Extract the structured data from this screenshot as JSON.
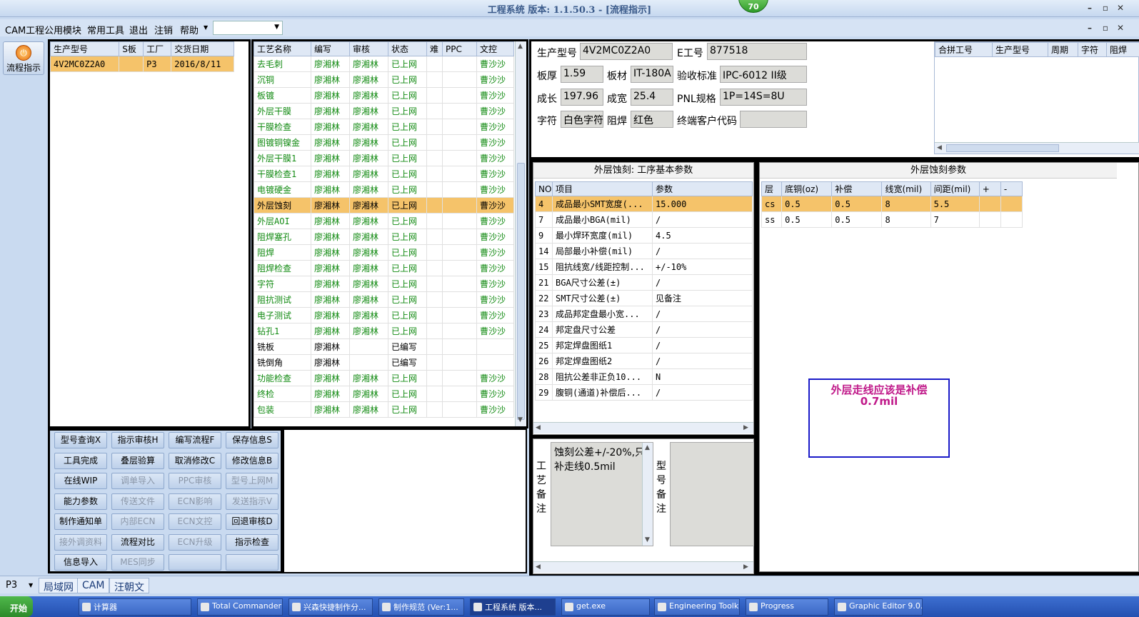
{
  "window": {
    "title": "工程系统  版本: 1.1.50.3 - [流程指示]",
    "badge": "70"
  },
  "menu": {
    "items": [
      "CAM工程",
      "公用模块",
      "常用工具",
      "退出",
      "注销",
      "帮助"
    ],
    "combo_value": ""
  },
  "sidebar": {
    "flow_button": "流程指示"
  },
  "order_table": {
    "headers": [
      "生产型号",
      "S板",
      "工厂",
      "交货日期"
    ],
    "rows": [
      [
        "4V2MC0Z2A0",
        "",
        "P3",
        "2016/8/11"
      ]
    ]
  },
  "process_table": {
    "headers": [
      "工艺名称",
      "编写",
      "审核",
      "状态",
      "难",
      "PPC",
      "文控"
    ],
    "selected_index": 9,
    "rows": [
      [
        "去毛刺",
        "廖湘林",
        "廖湘林",
        "已上网",
        "",
        "",
        "曹沙沙"
      ],
      [
        "沉铜",
        "廖湘林",
        "廖湘林",
        "已上网",
        "",
        "",
        "曹沙沙"
      ],
      [
        "板镀",
        "廖湘林",
        "廖湘林",
        "已上网",
        "",
        "",
        "曹沙沙"
      ],
      [
        "外层干膜",
        "廖湘林",
        "廖湘林",
        "已上网",
        "",
        "",
        "曹沙沙"
      ],
      [
        "干膜检查",
        "廖湘林",
        "廖湘林",
        "已上网",
        "",
        "",
        "曹沙沙"
      ],
      [
        "图镀铜镍金",
        "廖湘林",
        "廖湘林",
        "已上网",
        "",
        "",
        "曹沙沙"
      ],
      [
        "外层干膜1",
        "廖湘林",
        "廖湘林",
        "已上网",
        "",
        "",
        "曹沙沙"
      ],
      [
        "干膜检查1",
        "廖湘林",
        "廖湘林",
        "已上网",
        "",
        "",
        "曹沙沙"
      ],
      [
        "电镀硬金",
        "廖湘林",
        "廖湘林",
        "已上网",
        "",
        "",
        "曹沙沙"
      ],
      [
        "外层蚀刻",
        "廖湘林",
        "廖湘林",
        "已上网",
        "",
        "",
        "曹沙沙"
      ],
      [
        "外层AOI",
        "廖湘林",
        "廖湘林",
        "已上网",
        "",
        "",
        "曹沙沙"
      ],
      [
        "阻焊塞孔",
        "廖湘林",
        "廖湘林",
        "已上网",
        "",
        "",
        "曹沙沙"
      ],
      [
        "阻焊",
        "廖湘林",
        "廖湘林",
        "已上网",
        "",
        "",
        "曹沙沙"
      ],
      [
        "阻焊检查",
        "廖湘林",
        "廖湘林",
        "已上网",
        "",
        "",
        "曹沙沙"
      ],
      [
        "字符",
        "廖湘林",
        "廖湘林",
        "已上网",
        "",
        "",
        "曹沙沙"
      ],
      [
        "阻抗测试",
        "廖湘林",
        "廖湘林",
        "已上网",
        "",
        "",
        "曹沙沙"
      ],
      [
        "电子测试",
        "廖湘林",
        "廖湘林",
        "已上网",
        "",
        "",
        "曹沙沙"
      ],
      [
        "钻孔1",
        "廖湘林",
        "廖湘林",
        "已上网",
        "",
        "",
        "曹沙沙"
      ],
      [
        "铣板",
        "廖湘林",
        "",
        "已编写",
        "",
        "",
        ""
      ],
      [
        "铣倒角",
        "廖湘林",
        "",
        "已编写",
        "",
        "",
        ""
      ],
      [
        "功能检查",
        "廖湘林",
        "廖湘林",
        "已上网",
        "",
        "",
        "曹沙沙"
      ],
      [
        "终检",
        "廖湘林",
        "廖湘林",
        "已上网",
        "",
        "",
        "曹沙沙"
      ],
      [
        "包装",
        "廖湘林",
        "廖湘林",
        "已上网",
        "",
        "",
        "曹沙沙"
      ]
    ]
  },
  "buttons": [
    [
      "型号查询X",
      "指示审核H",
      "编写流程F",
      "保存信息S"
    ],
    [
      "工具完成",
      "叠层验算",
      "取消修改C",
      "修改信息B"
    ],
    [
      "在线WIP",
      "调单导入",
      "PPC审核",
      "型号上网M"
    ],
    [
      "能力参数",
      "传送文件",
      "ECN影响",
      "发送指示V"
    ],
    [
      "制作通知单",
      "内部ECN",
      "ECN文控",
      "回退审核D"
    ],
    [
      "接外调资料",
      "流程对比",
      "ECN升级",
      "指示检查"
    ],
    [
      "信息导入",
      "MES同步",
      "",
      ""
    ]
  ],
  "button_disabled": [
    [
      false,
      false,
      false,
      false
    ],
    [
      false,
      false,
      false,
      false
    ],
    [
      false,
      true,
      true,
      true
    ],
    [
      false,
      true,
      true,
      true
    ],
    [
      false,
      true,
      true,
      false
    ],
    [
      true,
      false,
      true,
      false
    ],
    [
      false,
      true,
      false,
      false
    ]
  ],
  "info": {
    "model_label": "生产型号",
    "model": "4V2MC0Z2A0",
    "e_label": "E工号",
    "e_no": "877518",
    "thick_label": "板厚",
    "thick": "1.59",
    "material_label": "板材",
    "material": "IT-180A",
    "std_label": "验收标准",
    "std": "IPC-6012 II级",
    "len_label": "成长",
    "len": "197.96",
    "wid_label": "成宽",
    "wid": "25.4",
    "pnl_label": "PNL规格",
    "pnl": "1P=14S=8U",
    "char_label": "字符",
    "char": "白色字符",
    "mask_label": "阻焊",
    "mask": "红色",
    "cust_label": "终端客户代码",
    "cust": ""
  },
  "merge_table": {
    "headers": [
      "合拼工号",
      "生产型号",
      "周期",
      "字符",
      "阻焊"
    ]
  },
  "params": {
    "title": "外层蚀刻: 工序基本参数",
    "headers": [
      "NO",
      "项目",
      "参数"
    ],
    "rows": [
      [
        "4",
        "成品最小SMT宽度(...",
        "15.000"
      ],
      [
        "7",
        "成品最小BGA(mil)",
        "/"
      ],
      [
        "9",
        "最小焊环宽度(mil)",
        "4.5"
      ],
      [
        "14",
        "局部最小补偿(mil)",
        "/"
      ],
      [
        "15",
        "阻抗线宽/线距控制...",
        "+/-10%"
      ],
      [
        "21",
        "BGA尺寸公差(±)",
        "/"
      ],
      [
        "22",
        "SMT尺寸公差(±)",
        "见备注"
      ],
      [
        "23",
        "成品邦定盘最小宽...",
        "/"
      ],
      [
        "24",
        "邦定盘尺寸公差",
        "/"
      ],
      [
        "25",
        "邦定焊盘图纸1",
        "/"
      ],
      [
        "26",
        "邦定焊盘图纸2",
        "/"
      ],
      [
        "28",
        "阻抗公差非正负10...",
        "N"
      ],
      [
        "29",
        "腹铜(通道)补偿后...",
        "/"
      ]
    ]
  },
  "etch": {
    "title": "外层蚀刻参数",
    "headers": [
      "层",
      "底铜(oz)",
      "补偿",
      "线宽(mil)",
      "间距(mil)",
      "+",
      "-"
    ],
    "rows": [
      [
        "cs",
        "0.5",
        "0.5",
        "8",
        "5.5",
        "",
        ""
      ],
      [
        "ss",
        "0.5",
        "0.5",
        "8",
        "7",
        "",
        ""
      ]
    ]
  },
  "note_box": {
    "text": "外层走线应该是补偿0.7mil"
  },
  "remarks": {
    "process_label": "工艺备注",
    "process_text": "蚀刻公差+/-20%,只补走线0.5mil",
    "model_label": "型号备注",
    "model_text": ""
  },
  "status": {
    "factory": "P3",
    "tabs": [
      "局域网",
      "CAM",
      "汪朝文"
    ]
  },
  "taskbar": {
    "start": "开始",
    "tasks": [
      "计算器",
      "Total Commander",
      "兴森快捷制作分...",
      "制作规范 (Ver:1...",
      "工程系统  版本...",
      "get.exe",
      "Engineering Toolki...",
      "Progress",
      "Graphic Editor 9.0..."
    ]
  },
  "colors": {
    "accent": "#f5c36a",
    "green_text": "#118a11",
    "note_border": "#1a1ac8",
    "note_text": "#c01a8a"
  }
}
